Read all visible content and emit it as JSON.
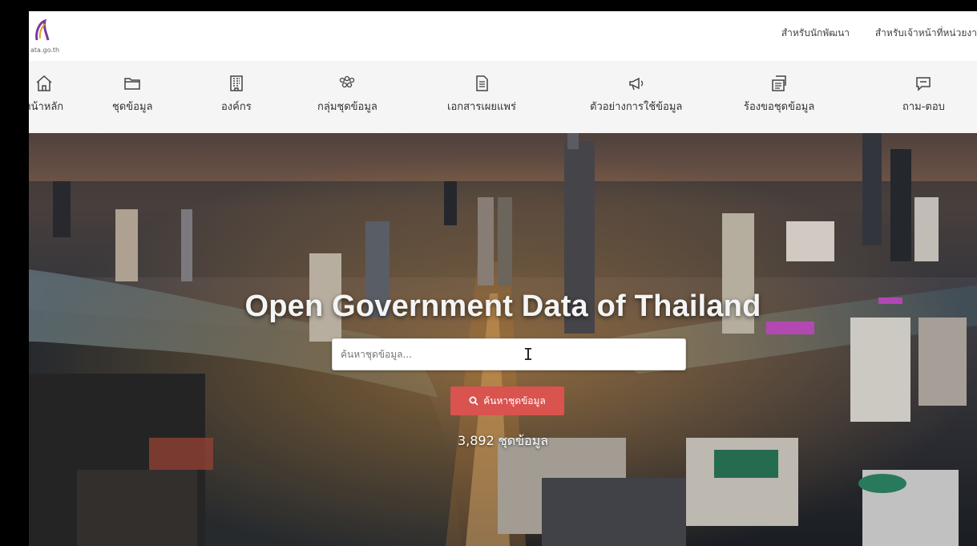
{
  "header": {
    "logo_text": "ata.go.th",
    "top_links": [
      "สำหรับนักพัฒนา",
      "สำหรับเจ้าหน้าที่หน่วยงา"
    ]
  },
  "nav": {
    "items": [
      {
        "label": "หน้าหลัก",
        "icon": "home-icon"
      },
      {
        "label": "ชุดข้อมูล",
        "icon": "folder-icon"
      },
      {
        "label": "องค์กร",
        "icon": "building-icon"
      },
      {
        "label": "กลุ่มชุดข้อมูล",
        "icon": "group-icon"
      },
      {
        "label": "เอกสารเผยแพร่",
        "icon": "document-icon"
      },
      {
        "label": "ตัวอย่างการใช้ข้อมูล",
        "icon": "megaphone-icon"
      },
      {
        "label": "ร้องขอชุดข้อมูล",
        "icon": "request-icon"
      },
      {
        "label": "ถาม-ตอบ",
        "icon": "chat-icon"
      }
    ]
  },
  "hero": {
    "title": "Open Government Data of Thailand",
    "search_placeholder": "ค้นหาชุดข้อมูล...",
    "search_button": "ค้นหาชุดข้อมูล",
    "count_text": "3,892 ชุดข้อมูล"
  },
  "colors": {
    "accent": "#d9534f",
    "nav_bg": "#f5f5f5"
  }
}
